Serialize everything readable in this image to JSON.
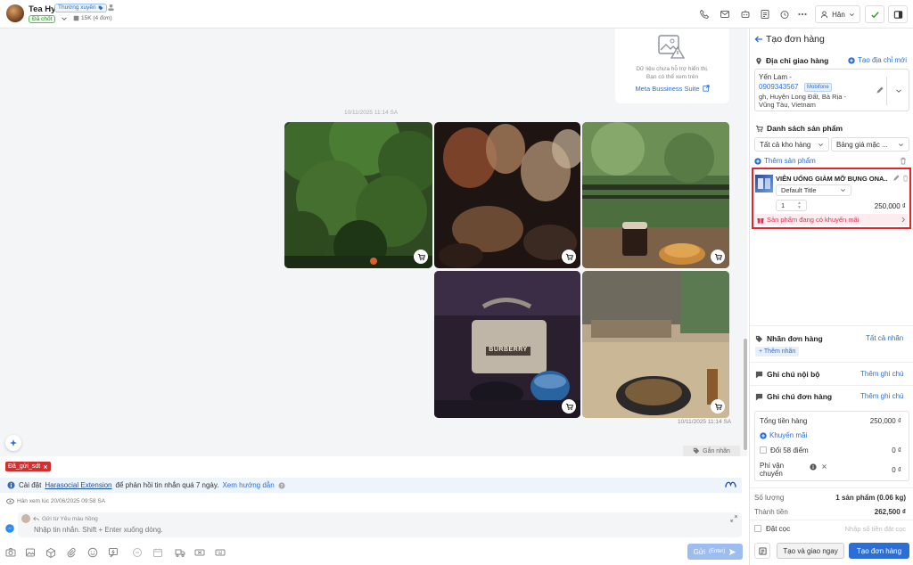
{
  "header": {
    "name": "Tea Hy",
    "tag": "Thường xuyên",
    "status": "Đã chốt",
    "stats": "15K (4 đơn)",
    "assignee": "Hân"
  },
  "chat": {
    "info_card": {
      "line1": "Dữ liệu chưa hỗ trợ hiển thị.",
      "line2": "Bạn có thể xem trên",
      "link": "Meta Bussiness Suite"
    },
    "date_separator": "10/11/2025 11:14 SA",
    "message_time": "10/11/2025 11:14 SA",
    "add_label": "Gắn nhãn"
  },
  "compose": {
    "chip": "Đã_gửi_sdt",
    "notice_prefix": "Cài đặt",
    "notice_link": "Harasocial Extension",
    "notice_text": "để phản hồi tin nhắn quá 7 ngày.",
    "notice_guide": "Xem hướng dẫn",
    "seen_text": "Hân xem lúc 20/06/2025 09:58 SA",
    "reply_from": "Gửi từ Yêu màu hồng",
    "input_placeholder": "Nhập tin nhắn. Shift + Enter xuống dòng.",
    "send_label": "Gửi",
    "send_hint": "(Enter)"
  },
  "panel": {
    "title": "Tạo đơn hàng",
    "address_heading": "Địa chỉ giao hàng",
    "new_address": "Tạo địa chỉ mới",
    "address": {
      "name": "Yến Lam -",
      "phone": "0909343567",
      "carrier": "Mobifone",
      "line1": "gh, Huyện Long Đất, Bà Rịa -",
      "line2": "Vũng Tàu, Vietnam"
    },
    "products_heading": "Danh sách sản phẩm",
    "warehouse_select": "Tất cả kho hàng",
    "pricelist_select": "Bảng giá mặc ...",
    "add_product": "Thêm sản phẩm",
    "product": {
      "name": "VIÊN UỐNG GIẢM MỠ BỤNG ONA...",
      "variant": "Default Title",
      "quantity": "1",
      "price": "250,000 ₫",
      "promo": "Sản phẩm đang có khuyến mãi"
    },
    "order_labels_heading": "Nhãn đơn hàng",
    "all_labels": "Tất cả nhãn",
    "add_label": "+ Thêm nhãn",
    "internal_note": "Ghi chú nội bộ",
    "order_note": "Ghi chú đơn hàng",
    "add_note": "Thêm ghi chú",
    "summary": {
      "total_label": "Tổng tiền hàng",
      "total_value": "250,000 ₫",
      "promo_label": "Khuyến mãi",
      "points_label": "Đổi 58 điểm",
      "points_value": "0 ₫",
      "shipping_label_1": "Phí vận",
      "shipping_label_2": "chuyển",
      "shipping_value": "0 ₫"
    },
    "quantity_label": "Số lượng",
    "quantity_value": "1 sản phẩm (0.06 kg)",
    "amount_label": "Thành tiền",
    "amount_value": "262,500 ₫",
    "deposit_label": "Đặt cọc",
    "deposit_placeholder": "Nhập số tiền đặt cọc",
    "create_deliver": "Tạo và giao ngay",
    "create_order": "Tạo đơn hàng"
  },
  "colors": {
    "accent": "#2b6fd6",
    "highlight_border": "#e0262b",
    "chip_red": "#d32f2f",
    "check_green": "#2e9e2e"
  }
}
